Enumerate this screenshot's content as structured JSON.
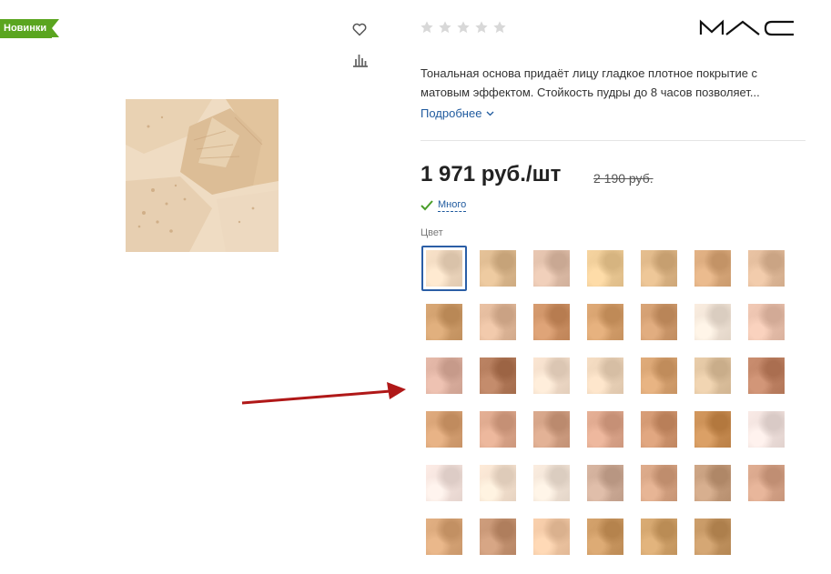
{
  "badge": {
    "label": "Новинки"
  },
  "icons": {
    "favorite": "heart-icon",
    "compare": "bar-chart-icon"
  },
  "rating": {
    "stars_filled": 0,
    "stars_total": 5
  },
  "brand": {
    "logo_text": "MAC"
  },
  "description": {
    "text": "Тональная основа придаёт лицу гладкое плотное покрытие с матовым эффектом. Стойкость пудры до 8 часов позволяет...",
    "more_label": "Подробнее"
  },
  "price": {
    "current": "1 971 руб./шт",
    "old": "2 190 руб."
  },
  "stock": {
    "label": "Много"
  },
  "colors": {
    "label": "Цвет",
    "selected_index": 0,
    "swatches": [
      "#efd8bf",
      "#dcb98f",
      "#dfbea9",
      "#ecca96",
      "#dcb586",
      "#d9a97c",
      "#e0ba9a",
      "#cf9e6c",
      "#e0b89a",
      "#cd9266",
      "#d5a06d",
      "#cf9b6e",
      "#f0e3d6",
      "#e8c0ac",
      "#dcb0a0",
      "#b27a5a",
      "#f1dcc9",
      "#ecd4ba",
      "#d6a271",
      "#dfc3a0",
      "#c08466",
      "#d6a174",
      "#dba68b",
      "#d1a084",
      "#dca68c",
      "#cf956f",
      "#c98e54",
      "#efe0dc",
      "#f3e2dc",
      "#f4e1cf",
      "#f1e3d6",
      "#ceac98",
      "#d5a383",
      "#c59d7d",
      "#d6a489",
      "#d8a679",
      "#c59473",
      "#f0c7a4",
      "#cb9963",
      "#d0a26b",
      "#c39562"
    ]
  }
}
